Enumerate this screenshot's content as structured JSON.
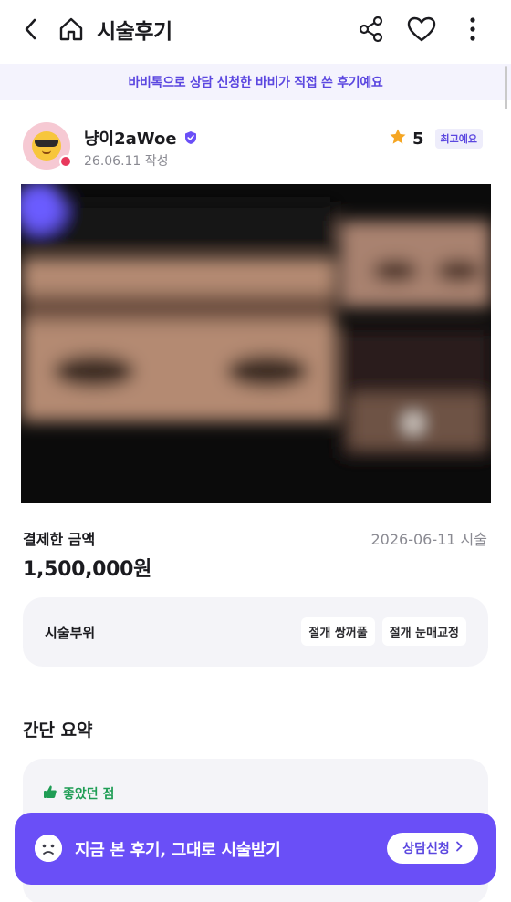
{
  "header": {
    "title": "시술후기"
  },
  "banner": {
    "text": "바비톡으로 상담 신청한 바비가 직접 쓴 후기예요"
  },
  "review": {
    "username": "냥이2aWoe",
    "date": "26.06.11 작성",
    "rating": "5",
    "badge": "최고예요"
  },
  "payment": {
    "label": "결제한 금액",
    "date": "2026-06-11 시술",
    "amount": "1,500,000원"
  },
  "area": {
    "label": "시술부위",
    "chips": [
      "절개 쌍꺼풀",
      "절개 눈매교정"
    ]
  },
  "summary": {
    "title": "간단 요약",
    "good_label": "좋았던 점"
  },
  "cta": {
    "text": "지금 본 후기, 그대로 시술받기",
    "button": "상담신청"
  },
  "colors": {
    "accent": "#6a4ff7",
    "banner_text": "#5b47e0",
    "good": "#1f9d55",
    "star": "#f5a623"
  },
  "icons": [
    "back-icon",
    "home-icon",
    "share-icon",
    "heart-icon",
    "more-icon",
    "verified-icon",
    "star-icon",
    "thumbs-up-icon",
    "sad-face-icon",
    "chevron-right-icon"
  ]
}
